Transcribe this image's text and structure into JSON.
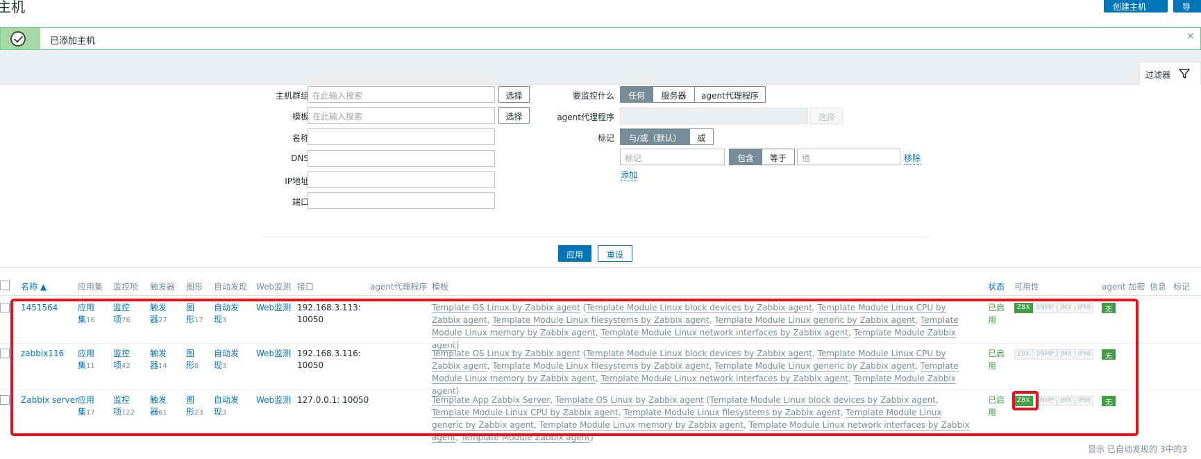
{
  "header": {
    "title": "主机",
    "create_button": "创建主机",
    "import_button": "导入"
  },
  "alert": {
    "message": "已添加主机",
    "close": "×"
  },
  "filter": {
    "tab_label": "过滤器",
    "host_groups_label": "主机群组",
    "host_groups_placeholder": "在此输入搜索",
    "select_label": "选择",
    "templates_label": "模板",
    "templates_placeholder": "在此输入搜索",
    "name_label": "名称",
    "dns_label": "DNS",
    "ip_label": "IP地址",
    "port_label": "端口",
    "monitored_by_label": "要监控什么",
    "monitored_by_options": [
      "任何",
      "服务器",
      "agent代理程序"
    ],
    "proxy_label": "agent代理程序",
    "tags_label": "标记",
    "tags_mode_options": [
      "与/或（默认）",
      "或"
    ],
    "tag_placeholder": "标记",
    "tag_operators": [
      "包含",
      "等于"
    ],
    "value_placeholder": "值",
    "remove_link": "移除",
    "add_link": "添加",
    "apply_button": "应用",
    "reset_button": "重设"
  },
  "table": {
    "headers": {
      "name": "名称 ▲",
      "applications": "应用集",
      "items": "监控项",
      "triggers": "触发器",
      "graphs": "图形",
      "discovery": "自动发现",
      "web": "Web监测",
      "interface": "接口",
      "proxy": "agent代理程序",
      "templates": "模板",
      "status": "状态",
      "availability": "可用性",
      "encryption": "agent 加密",
      "info": "信息",
      "tags": "标记"
    },
    "labels": {
      "app_a": "应用",
      "app_b": "集",
      "items_a": "监控",
      "items_b": "项",
      "trig_a": "触发",
      "trig_b": "器",
      "graph_a": "图",
      "graph_b": "形",
      "disc_a": "自动发",
      "disc_b": "现",
      "web": "Web监测",
      "status_a": "已启",
      "status_b": "用",
      "enc": "无"
    },
    "avail_badges": [
      "ZBX",
      "SNMP",
      "JMX",
      "IPMI"
    ],
    "rows": [
      {
        "name": "1451564",
        "app_count": "16",
        "item_count": "76",
        "trigger_count": "27",
        "graph_count": "17",
        "discovery_count": "3",
        "interface_a": "192.168.3.113:",
        "interface_b": "10050",
        "zbx_available": true,
        "tmpl_parts": [
          "Template OS Linux by Zabbix agent",
          " (",
          "Template Module Linux block devices by Zabbix agent",
          ", ",
          "Template Module Linux CPU by Zabbix agent",
          ", ",
          "Template Module Linux filesystems by Zabbix agent",
          ", ",
          "Template Module Linux generic by Zabbix agent",
          ", ",
          "Template Module Linux memory by Zabbix agent",
          ", ",
          "Template Module Linux network interfaces by Zabbix agent",
          ", ",
          "Template Module Zabbix agent",
          ")"
        ]
      },
      {
        "name": "zabbix116",
        "app_count": "11",
        "item_count": "42",
        "trigger_count": "14",
        "graph_count": "8",
        "discovery_count": "3",
        "interface_a": "192.168.3.116:",
        "interface_b": "10050",
        "zbx_available": false,
        "tmpl_parts": [
          "Template OS Linux by Zabbix agent",
          " (",
          "Template Module Linux block devices by Zabbix agent",
          ", ",
          "Template Module Linux CPU by Zabbix agent",
          ", ",
          "Template Module Linux filesystems by Zabbix agent",
          ", ",
          "Template Module Linux generic by Zabbix agent",
          ", ",
          "Template Module Linux memory by Zabbix agent",
          ", ",
          "Template Module Linux network interfaces by Zabbix agent",
          ", ",
          "Template Module Zabbix agent",
          ")"
        ]
      },
      {
        "name": "Zabbix server",
        "app_count": "17",
        "item_count": "122",
        "trigger_count": "61",
        "graph_count": "23",
        "discovery_count": "3",
        "interface_a": "127.0.0.1: 10050",
        "interface_b": "",
        "zbx_available": true,
        "tmpl_parts": [
          "Template App Zabbix Server",
          ", ",
          "Template OS Linux by Zabbix agent",
          " (",
          "Template Module Linux block devices by Zabbix agent",
          ", ",
          "Template Module Linux CPU by Zabbix agent",
          ", ",
          "Template Module Linux filesystems by Zabbix agent",
          ", ",
          "Template Module Linux generic by Zabbix agent",
          ", ",
          "Template Module Linux memory by Zabbix agent",
          ", ",
          "Template Module Linux network interfaces by Zabbix agent",
          ", ",
          "Template Module Zabbix agent",
          ")"
        ]
      }
    ]
  },
  "footer": {
    "text": "显示 已自动发现的 3中的3"
  },
  "colors": {
    "accent": "#0275b8",
    "success": "#429e47",
    "highlight": "#e8111b"
  }
}
